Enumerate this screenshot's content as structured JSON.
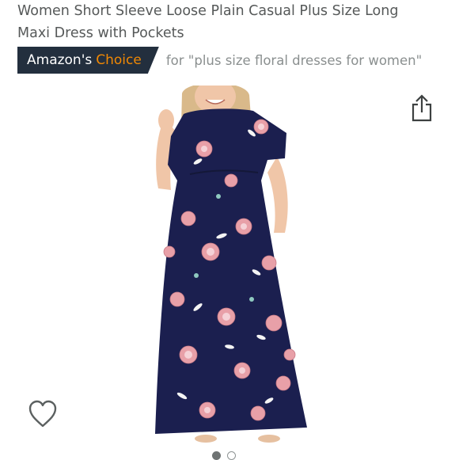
{
  "product": {
    "title_line1": "Women Short Sleeve Loose Plain Casual Plus Size Long",
    "title_line2": "Maxi Dress with Pockets"
  },
  "badge": {
    "amazons": "Amazon's",
    "choice": "Choice",
    "for_text": "for \"plus size floral dresses for women\""
  },
  "icons": {
    "share": "share-icon",
    "wishlist": "heart-icon"
  },
  "image_carousel": {
    "total_images": 2,
    "current_index": 1
  },
  "colors": {
    "badge_bg": "#232f3e",
    "badge_accent": "#f08804",
    "dress_navy": "#1b1f4f",
    "flower_pink": "#e8a0a8"
  }
}
